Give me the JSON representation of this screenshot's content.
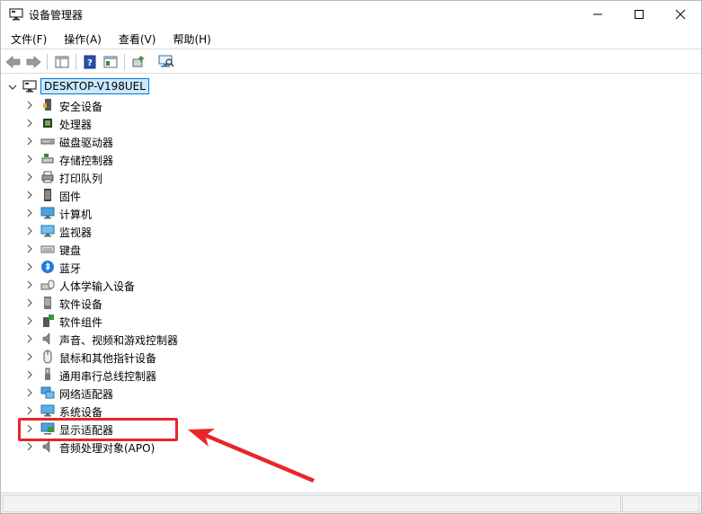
{
  "window": {
    "title": "设备管理器",
    "controls": {
      "minimize": "minimize",
      "maximize": "maximize",
      "close": "close"
    }
  },
  "menu": [
    {
      "label": "文件(F)"
    },
    {
      "label": "操作(A)"
    },
    {
      "label": "查看(V)"
    },
    {
      "label": "帮助(H)"
    }
  ],
  "tree": {
    "root": "DESKTOP-V198UEL",
    "items": [
      {
        "label": "安全设备",
        "icon": "security-device-icon"
      },
      {
        "label": "处理器",
        "icon": "processor-icon"
      },
      {
        "label": "磁盘驱动器",
        "icon": "disk-drive-icon"
      },
      {
        "label": "存储控制器",
        "icon": "storage-controller-icon"
      },
      {
        "label": "打印队列",
        "icon": "print-queue-icon"
      },
      {
        "label": "固件",
        "icon": "firmware-icon"
      },
      {
        "label": "计算机",
        "icon": "computer-icon"
      },
      {
        "label": "监视器",
        "icon": "monitor-icon"
      },
      {
        "label": "键盘",
        "icon": "keyboard-icon"
      },
      {
        "label": "蓝牙",
        "icon": "bluetooth-icon"
      },
      {
        "label": "人体学输入设备",
        "icon": "hid-icon"
      },
      {
        "label": "软件设备",
        "icon": "software-device-icon"
      },
      {
        "label": "软件组件",
        "icon": "software-component-icon"
      },
      {
        "label": "声音、视频和游戏控制器",
        "icon": "sound-icon"
      },
      {
        "label": "鼠标和其他指针设备",
        "icon": "mouse-icon"
      },
      {
        "label": "通用串行总线控制器",
        "icon": "usb-icon"
      },
      {
        "label": "网络适配器",
        "icon": "network-adapter-icon"
      },
      {
        "label": "系统设备",
        "icon": "system-device-icon"
      },
      {
        "label": "显示适配器",
        "icon": "display-adapter-icon"
      },
      {
        "label": "音频处理对象(APO)",
        "icon": "audio-apo-icon"
      }
    ]
  },
  "annotation": {
    "highlighted_item": "显示适配器",
    "color": "#e8262a"
  },
  "colors": {
    "selection_bg": "#cce8ff",
    "selection_border": "#0078d7",
    "accent_red": "#e8262a"
  }
}
